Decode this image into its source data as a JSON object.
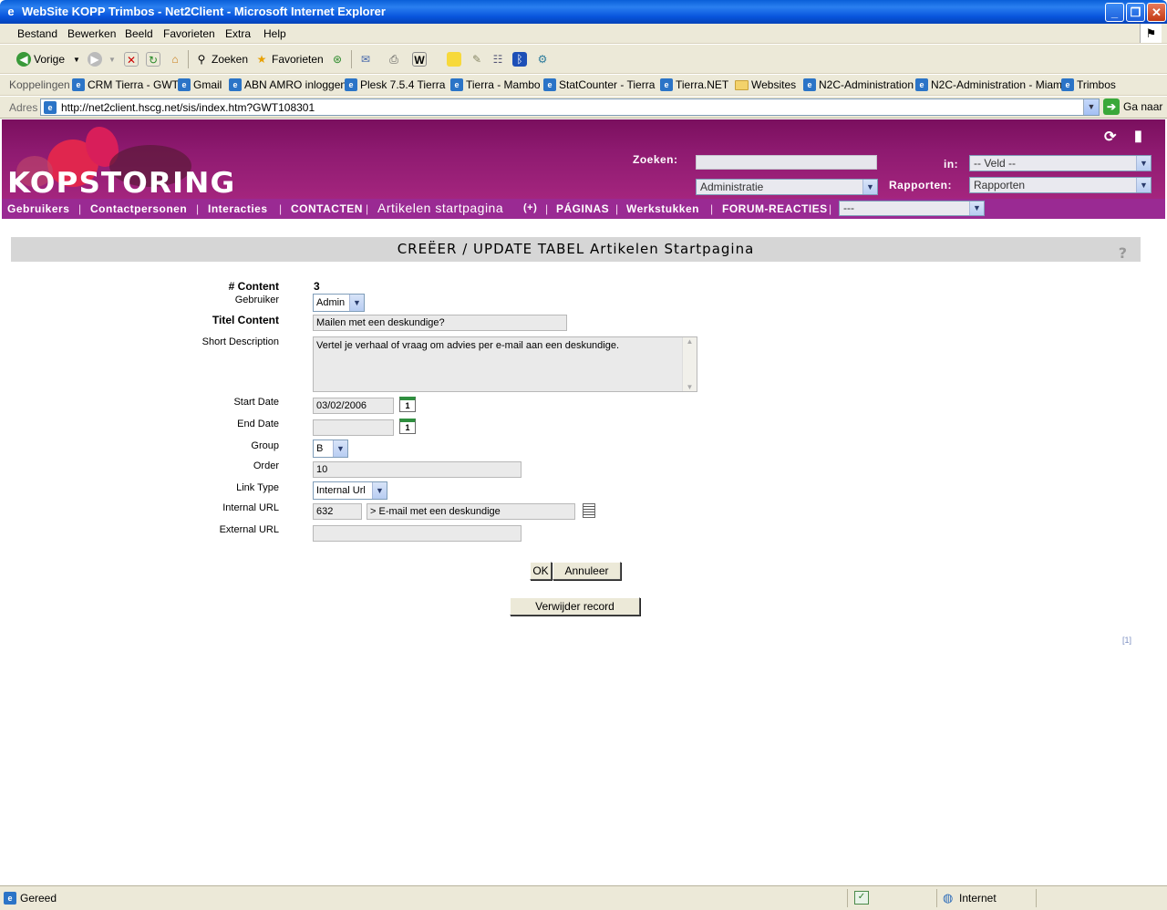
{
  "window": {
    "title": "WebSite KOPP Trimbos - Net2Client - Microsoft Internet Explorer"
  },
  "menu": [
    "Bestand",
    "Bewerken",
    "Beeld",
    "Favorieten",
    "Extra",
    "Help"
  ],
  "toolbar": {
    "back": "Vorige",
    "search": "Zoeken",
    "favorites": "Favorieten"
  },
  "links": {
    "label": "Koppelingen",
    "items": [
      "CRM Tierra - GWT",
      "Gmail",
      "ABN AMRO inloggen",
      "Plesk 7.5.4 Tierra",
      "Tierra - Mambo",
      "StatCounter - Tierra",
      "Tierra.NET",
      "Websites",
      "N2C-Administration",
      "N2C-Administration - Miami",
      "Trimbos"
    ]
  },
  "address": {
    "label": "Adres",
    "url": "http://net2client.hscg.net/sis/index.htm?GWT108301",
    "go": "Ga naar"
  },
  "site": {
    "logo": "KOPSTORING",
    "search_label": "Zoeken:",
    "search_value": "",
    "in_label": "in:",
    "field_select": "-- Veld --",
    "admin_select": "Administratie",
    "reports_label": "Rapporten:",
    "reports_select": "Rapporten"
  },
  "nav": {
    "items": [
      "Gebruikers",
      "Contactpersonen",
      "Interacties",
      "CONTACTEN",
      "Artikelen startpagina",
      "PÁGINAS",
      "Werkstukken",
      "FORUM-REACTIES"
    ],
    "plus": "(+)",
    "select": "---"
  },
  "form": {
    "title": "CREËER / UPDATE TABEL Artikelen Startpagina",
    "help": "?",
    "content_label": "# Content",
    "content_value": "3",
    "user_label": "Gebruiker",
    "user_value": "Admin",
    "title_label": "Titel Content",
    "title_value": "Mailen met een deskundige?",
    "desc_label": "Short Description",
    "desc_value": "Vertel je verhaal of vraag om advies per e-mail aan een deskundige.",
    "start_label": "Start Date",
    "start_value": "03/02/2006",
    "end_label": "End Date",
    "end_value": "",
    "group_label": "Group",
    "group_value": "B",
    "order_label": "Order",
    "order_value": "10",
    "linktype_label": "Link Type",
    "linktype_value": "Internal Url",
    "internal_label": "Internal URL",
    "internal_id": "632",
    "internal_title": "> E-mail met een deskundige",
    "external_label": "External URL",
    "external_value": "",
    "ok": "OK",
    "cancel": "Annuleer",
    "delete": "Verwijder record",
    "page_index": "[1]"
  },
  "status": {
    "text": "Gereed",
    "zone": "Internet"
  }
}
